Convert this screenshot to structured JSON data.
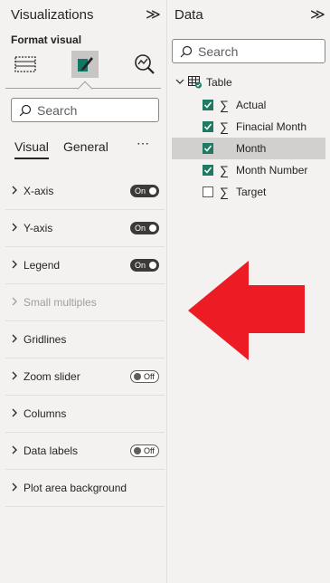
{
  "visualizations": {
    "title": "Visualizations",
    "collapse_glyph": "≫",
    "format_label": "Format visual",
    "search_placeholder": "Search",
    "tabs": [
      {
        "label": "Visual",
        "active": true
      },
      {
        "label": "General",
        "active": false
      }
    ],
    "more_glyph": "⋯",
    "cards": [
      {
        "label": "X-axis",
        "toggle": "On"
      },
      {
        "label": "Y-axis",
        "toggle": "On"
      },
      {
        "label": "Legend",
        "toggle": "On"
      },
      {
        "label": "Small multiples",
        "toggle": null,
        "disabled": true
      },
      {
        "label": "Gridlines",
        "toggle": null
      },
      {
        "label": "Zoom slider",
        "toggle": "Off"
      },
      {
        "label": "Columns",
        "toggle": null
      },
      {
        "label": "Data labels",
        "toggle": "Off"
      },
      {
        "label": "Plot area background",
        "toggle": null
      }
    ]
  },
  "data": {
    "title": "Data",
    "collapse_glyph": "≫",
    "search_placeholder": "Search",
    "table_name": "Table",
    "fields": [
      {
        "name": "Actual",
        "checked": true,
        "sigma": true
      },
      {
        "name": "Finacial Month",
        "checked": true,
        "sigma": true
      },
      {
        "name": "Month",
        "checked": true,
        "sigma": false,
        "selected": true
      },
      {
        "name": "Month Number",
        "checked": true,
        "sigma": true
      },
      {
        "name": "Target",
        "checked": false,
        "sigma": true
      }
    ]
  },
  "colors": {
    "check_green": "#1f7a64",
    "arrow_red": "#ed1c24"
  }
}
